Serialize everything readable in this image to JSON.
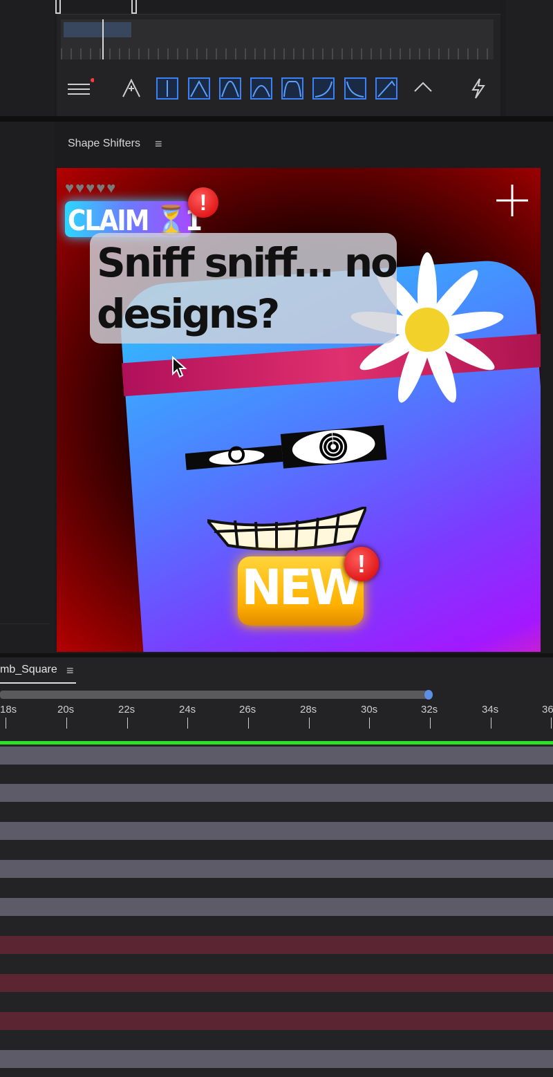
{
  "panel": {
    "title": "Shape Shifters"
  },
  "preview": {
    "claim_label": "CLAIM ⏳1",
    "speech_text": "Sniff sniff... no designs?",
    "new_label": "NEW",
    "alert_glyph": "!",
    "hearts": "♥♥♥♥♥"
  },
  "timeline": {
    "tab_label": "mb_Square",
    "ticks": [
      "18s",
      "20s",
      "22s",
      "24s",
      "26s",
      "28s",
      "30s",
      "32s",
      "34s",
      "36"
    ]
  },
  "colors": {
    "accent_blue": "#3b82f6",
    "playhead_green": "#2ee02a",
    "track_gray": "#5d5b68",
    "track_red": "#5b2532"
  }
}
